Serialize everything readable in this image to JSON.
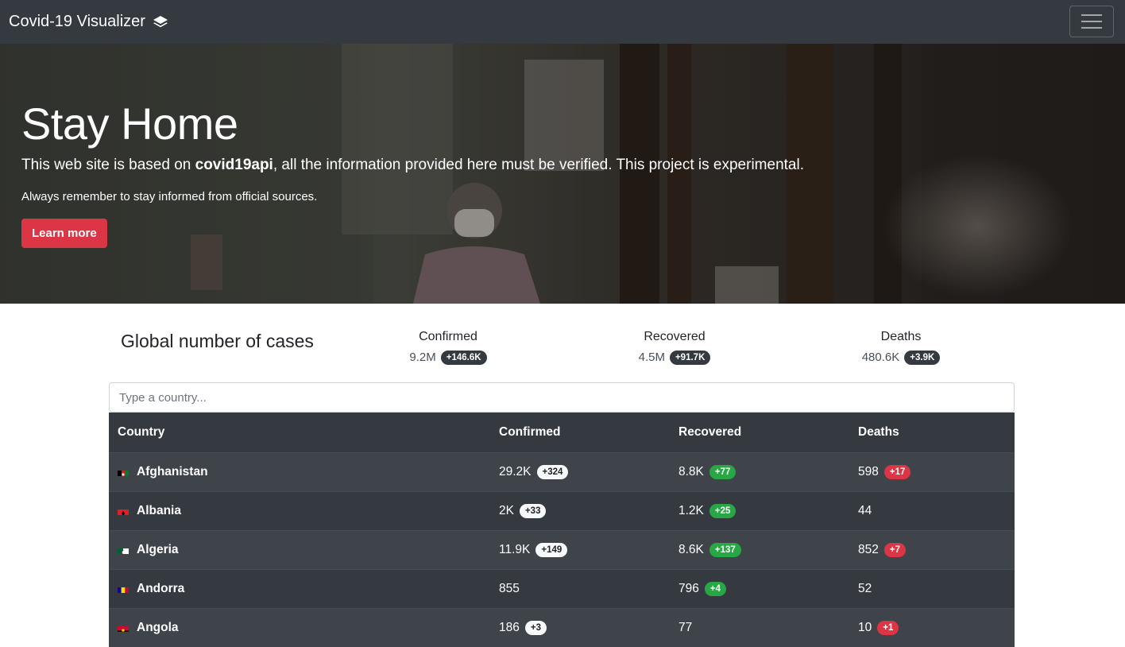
{
  "navbar": {
    "brand": "Covid-19 Visualizer",
    "brand_icon": "layers-icon",
    "menu_icon": "hamburger-menu-icon"
  },
  "hero": {
    "title": "Stay Home",
    "lead_prefix": "This web site is based on ",
    "lead_bold": "covid19api",
    "lead_suffix": ", all the information provided here must be verified. This project is experimental.",
    "note": "Always remember to stay informed from official sources.",
    "button": "Learn more"
  },
  "global": {
    "title": "Global number of cases",
    "confirmed": {
      "label": "Confirmed",
      "value": "9.2M",
      "delta": "+146.6K"
    },
    "recovered": {
      "label": "Recovered",
      "value": "4.5M",
      "delta": "+91.7K"
    },
    "deaths": {
      "label": "Deaths",
      "value": "480.6K",
      "delta": "+3.9K"
    }
  },
  "search": {
    "placeholder": "Type a country..."
  },
  "table": {
    "headers": {
      "country": "Country",
      "confirmed": "Confirmed",
      "recovered": "Recovered",
      "deaths": "Deaths"
    },
    "rows": [
      {
        "country": "Afghanistan",
        "confirmed": "29.2K",
        "confirmed_delta": "+324",
        "recovered": "8.8K",
        "recovered_delta": "+77",
        "deaths": "598",
        "deaths_delta": "+17"
      },
      {
        "country": "Albania",
        "confirmed": "2K",
        "confirmed_delta": "+33",
        "recovered": "1.2K",
        "recovered_delta": "+25",
        "deaths": "44",
        "deaths_delta": ""
      },
      {
        "country": "Algeria",
        "confirmed": "11.9K",
        "confirmed_delta": "+149",
        "recovered": "8.6K",
        "recovered_delta": "+137",
        "deaths": "852",
        "deaths_delta": "+7"
      },
      {
        "country": "Andorra",
        "confirmed": "855",
        "confirmed_delta": "",
        "recovered": "796",
        "recovered_delta": "+4",
        "deaths": "52",
        "deaths_delta": ""
      },
      {
        "country": "Angola",
        "confirmed": "186",
        "confirmed_delta": "+3",
        "recovered": "77",
        "recovered_delta": "",
        "deaths": "10",
        "deaths_delta": "+1"
      }
    ]
  },
  "colors": {
    "navbar": "#343a40",
    "danger": "#dc3545",
    "success": "#28a745",
    "table_dark": "#343a40",
    "table_stripe": "#3e444a"
  }
}
